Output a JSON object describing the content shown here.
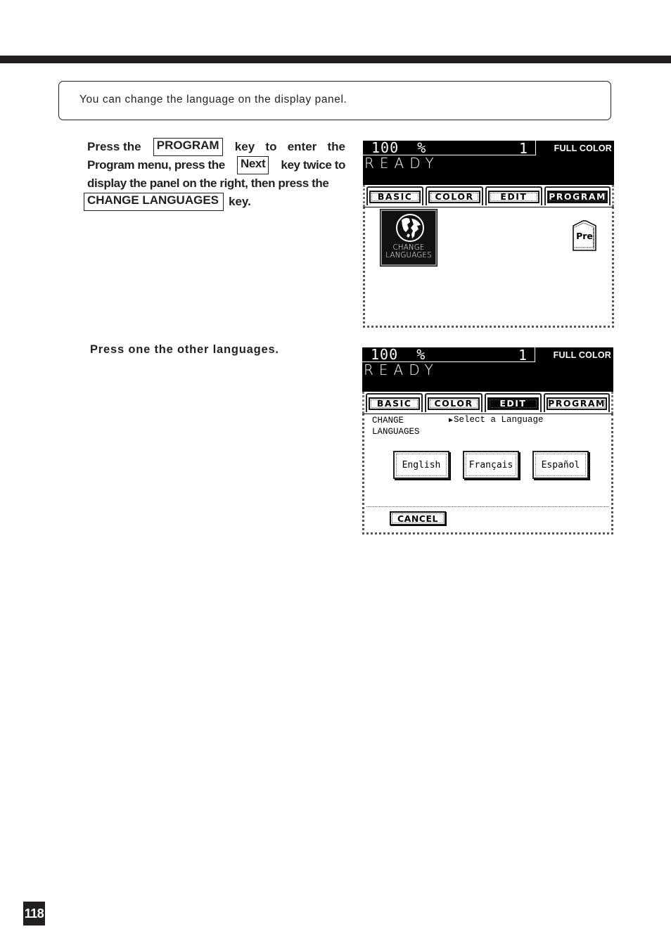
{
  "note": "You can change the language on the display panel.",
  "step1": {
    "line1": {
      "pre": "Press the",
      "key": "PROGRAM",
      "post": [
        "key",
        "to",
        "enter",
        "the"
      ]
    },
    "line2": {
      "pre": "Program menu, press the",
      "key": "Next",
      "post": "key twice to"
    },
    "line3": "display the panel on the right, then press the",
    "line4": {
      "key": "CHANGE LANGUAGES",
      "post": "key."
    }
  },
  "step2": "Press one the other languages.",
  "panel1": {
    "zoom": "100  %",
    "copies": "1",
    "mode": "FULL COLOR",
    "status": "READY",
    "tabs": [
      {
        "label": "BASIC",
        "active": false
      },
      {
        "label": "COLOR",
        "active": false
      },
      {
        "label": "EDIT",
        "active": false
      },
      {
        "label": "PROGRAM",
        "active": true
      }
    ],
    "change_languages_icon": {
      "line1": "CHANGE",
      "line2": "LANGUAGES",
      "icon": "globe-icon"
    },
    "pre_button": {
      "label": "Pre",
      "icon": "preset-tab-icon"
    }
  },
  "panel2": {
    "zoom": "100  %",
    "copies": "1",
    "mode": "FULL COLOR",
    "status": "READY",
    "tabs": [
      {
        "label": "BASIC",
        "active": false
      },
      {
        "label": "COLOR",
        "active": false
      },
      {
        "label": "EDIT",
        "active": true
      },
      {
        "label": "PROGRAM",
        "active": false
      }
    ],
    "title_line1": "CHANGE",
    "title_line2": "LANGUAGES",
    "prompt": "Select a Language",
    "languages": [
      "English",
      "Français",
      "Español"
    ],
    "cancel": "CANCEL"
  },
  "page_number": "118"
}
